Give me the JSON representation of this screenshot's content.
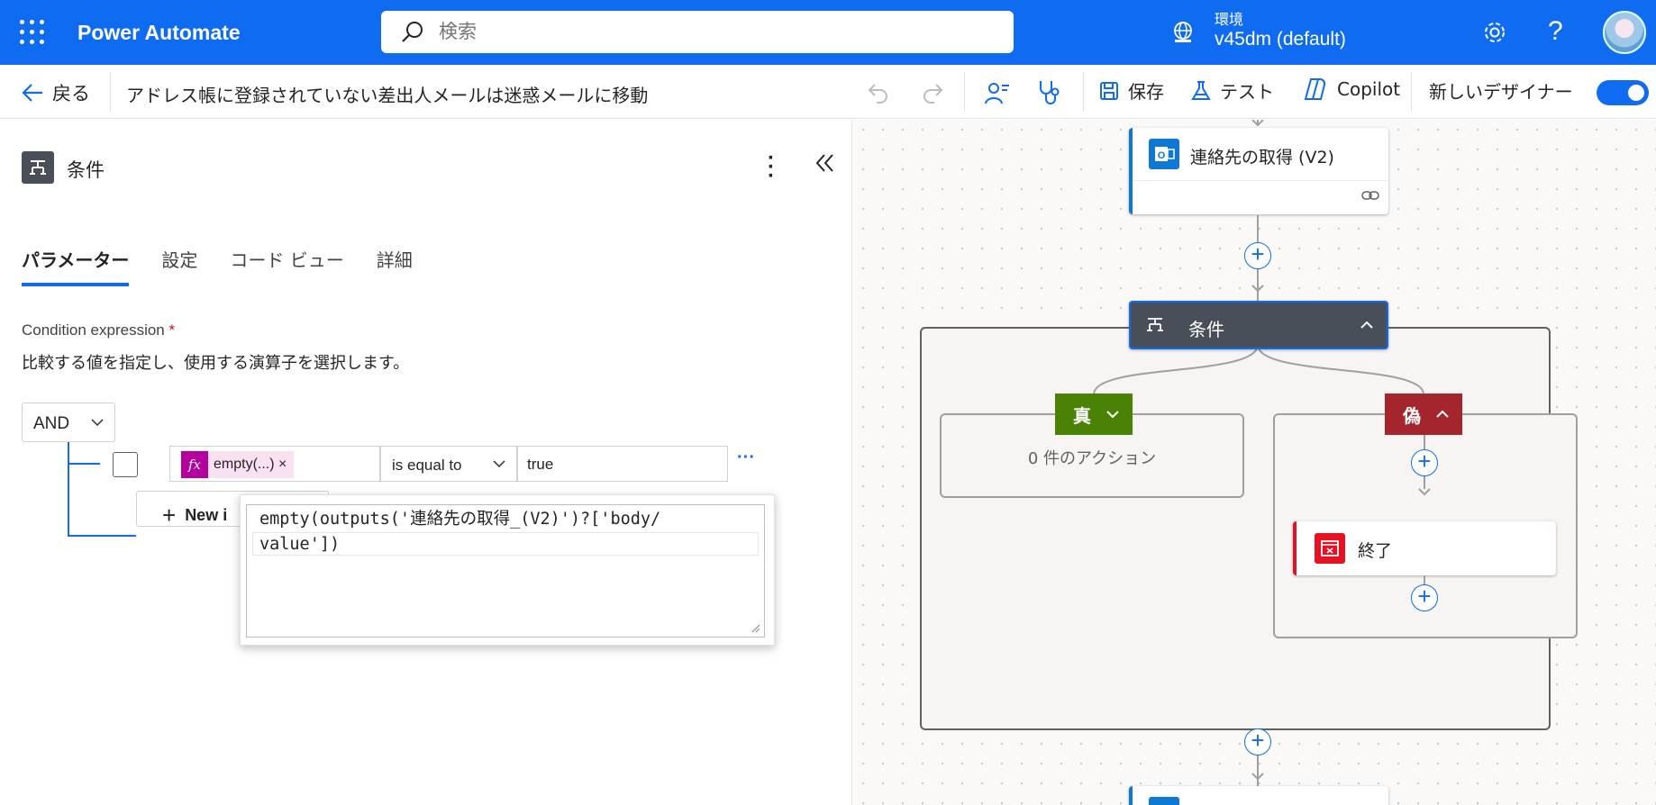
{
  "header": {
    "app_title": "Power Automate",
    "search_placeholder": "検索",
    "env_label": "環境",
    "env_name": "v45dm (default)"
  },
  "cmdbar": {
    "back_label": "戻る",
    "flow_name": "アドレス帳に登録されていない差出人メールは迷惑メールに移動",
    "save_label": "保存",
    "test_label": "テスト",
    "copilot_label": "Copilot",
    "new_designer_label": "新しいデザイナー",
    "new_designer_on": true
  },
  "panel": {
    "title": "条件",
    "tabs": [
      {
        "label": "パラメーター",
        "active": true
      },
      {
        "label": "設定",
        "active": false
      },
      {
        "label": "コード ビュー",
        "active": false
      },
      {
        "label": "詳細",
        "active": false
      }
    ],
    "condition_label": "Condition expression",
    "required_mark": "*",
    "condition_desc": "比較する値を指定し、使用する演算子を選択します。",
    "group_operator": "AND",
    "row": {
      "lhs_token": "empty(...)",
      "token_close": "×",
      "operator": "is equal to",
      "rhs": "true",
      "more": "···"
    },
    "new_item_label": "New i",
    "expression_popup": {
      "line1": "empty(outputs('連絡先の取得_(V2)')?['body/",
      "line2": "value'])"
    }
  },
  "canvas": {
    "get_contacts_title": "連絡先の取得 (V2)",
    "condition_title": "条件",
    "true_label": "真",
    "false_label": "偽",
    "true_empty": "0 件のアクション",
    "terminate_title": "終了",
    "colors": {
      "true_branch": "#498205",
      "false_branch": "#a4262c",
      "condition_header": "#484f58",
      "outlook": "#0f78d4",
      "terminate": "#e81123"
    }
  }
}
